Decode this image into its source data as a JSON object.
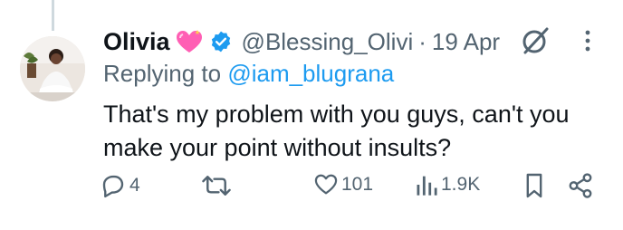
{
  "tweet": {
    "author_name": "Olivia",
    "name_emoji": "heart-icon",
    "verified": true,
    "handle": "@Blessing_Olivi",
    "separator": "·",
    "date": "19 Apr",
    "replying_to_prefix": "Replying to",
    "replying_to_handle": "@iam_blugrana",
    "text": "That's my problem with you guys, can't you make your point without insults?"
  },
  "actions": {
    "replies": "4",
    "retweets": "",
    "likes": "101",
    "views": "1.9K"
  },
  "colors": {
    "text": "#0f1419",
    "muted": "#536471",
    "link": "#1d9bf0",
    "verified": "#1d9bf0",
    "heart": "#ff5fb4"
  }
}
